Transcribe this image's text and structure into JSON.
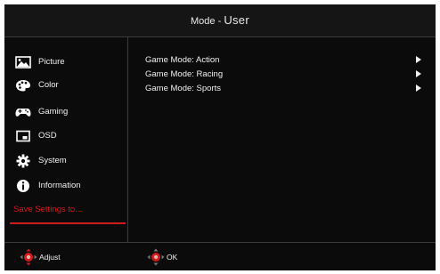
{
  "header": {
    "prefix": "Mode - ",
    "mode": "User"
  },
  "sidebar": {
    "items": [
      {
        "label": "Picture",
        "icon": "picture-icon"
      },
      {
        "label": "Color",
        "icon": "palette-icon"
      },
      {
        "label": "Gaming",
        "icon": "gamepad-icon"
      },
      {
        "label": "OSD",
        "icon": "osd-icon"
      },
      {
        "label": "System",
        "icon": "gear-icon"
      },
      {
        "label": "Information",
        "icon": "info-icon"
      }
    ],
    "save_label": "Save Settings to...",
    "save_color": "#d11a1a"
  },
  "content": {
    "items": [
      {
        "label": "Game Mode: Action"
      },
      {
        "label": "Game Mode: Racing"
      },
      {
        "label": "Game Mode: Sports"
      }
    ]
  },
  "footer": {
    "adjust_label": "Adjust",
    "ok_label": "OK",
    "accent": "#d11a1a"
  }
}
